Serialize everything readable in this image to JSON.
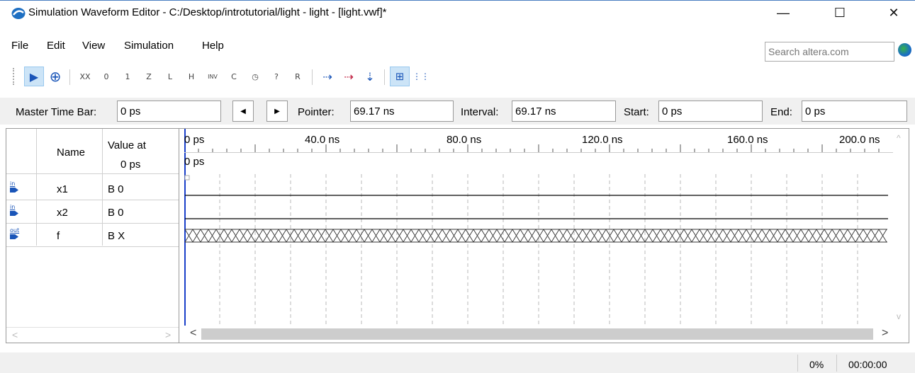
{
  "window": {
    "title": "Simulation Waveform Editor - C:/Desktop/introtutorial/light - light - [light.vwf]*",
    "minimize_glyph": "—",
    "maximize_glyph": "☐",
    "close_glyph": "✕"
  },
  "menu": {
    "items": [
      "File",
      "Edit",
      "View",
      "Simulation",
      "Help"
    ]
  },
  "search": {
    "placeholder": "Search altera.com"
  },
  "toolbar": {
    "buttons": [
      {
        "icon": "select-arrow-icon",
        "glyph": "▶",
        "active": true
      },
      {
        "icon": "zoom-icon",
        "glyph": "⊕"
      },
      {
        "icon": "force-unknown-icon",
        "glyph": "XX"
      },
      {
        "icon": "force-low-icon",
        "glyph": "0"
      },
      {
        "icon": "force-high-icon",
        "glyph": "1"
      },
      {
        "icon": "force-high-impedance-icon",
        "glyph": "Z"
      },
      {
        "icon": "weak-low-icon",
        "glyph": "L"
      },
      {
        "icon": "weak-high-icon",
        "glyph": "H"
      },
      {
        "icon": "invert-icon",
        "glyph": "INV"
      },
      {
        "icon": "count-value-icon",
        "glyph": "C"
      },
      {
        "icon": "overwrite-clock-icon",
        "glyph": "◷"
      },
      {
        "icon": "arbitrary-value-icon",
        "glyph": "?"
      },
      {
        "icon": "random-values-icon",
        "glyph": "R"
      },
      {
        "icon": "run-functional-simulation-icon",
        "glyph": "⇢"
      },
      {
        "icon": "run-timing-simulation-icon",
        "glyph": "⇢"
      },
      {
        "icon": "generate-netlist-icon",
        "glyph": "⇣"
      },
      {
        "icon": "snap-to-grid-icon",
        "glyph": "⊞",
        "active": true
      },
      {
        "icon": "sort-icon",
        "glyph": "⋮⋮"
      }
    ]
  },
  "timebar": {
    "master_label": "Master Time Bar:",
    "master_value": "0 ps",
    "prev_glyph": "◀",
    "next_glyph": "▶",
    "pointer_label": "Pointer:",
    "pointer_value": "69.17 ns",
    "interval_label": "Interval:",
    "interval_value": "69.17 ns",
    "start_label": "Start:",
    "start_value": "0 ps",
    "end_label": "End:",
    "end_value": "0 ps"
  },
  "signals": {
    "header_name": "Name",
    "header_value_line1": "Value at",
    "header_value_line2": "0 ps",
    "rows": [
      {
        "direction": "in",
        "name": "x1",
        "value": "B 0"
      },
      {
        "direction": "in",
        "name": "x2",
        "value": "B 0"
      },
      {
        "direction": "out",
        "name": "f",
        "value": "B X"
      }
    ]
  },
  "waveform": {
    "scale_labels": [
      "0 ps",
      "40.0 ns",
      "80.0 ns",
      "120.0 ns",
      "160.0 ns",
      "200.0 ns"
    ],
    "cursor_label": "0 ps",
    "signal_levels": [
      "low",
      "low",
      "unknown"
    ],
    "colors": {
      "cursor": "#1a3fc9",
      "grid": "#b8b8b8",
      "wave": "#000000"
    }
  },
  "status": {
    "progress": "0%",
    "elapsed": "00:00:00"
  },
  "scroll_glyphs": {
    "left": "<",
    "right": ">",
    "up": "^",
    "down": "v"
  }
}
